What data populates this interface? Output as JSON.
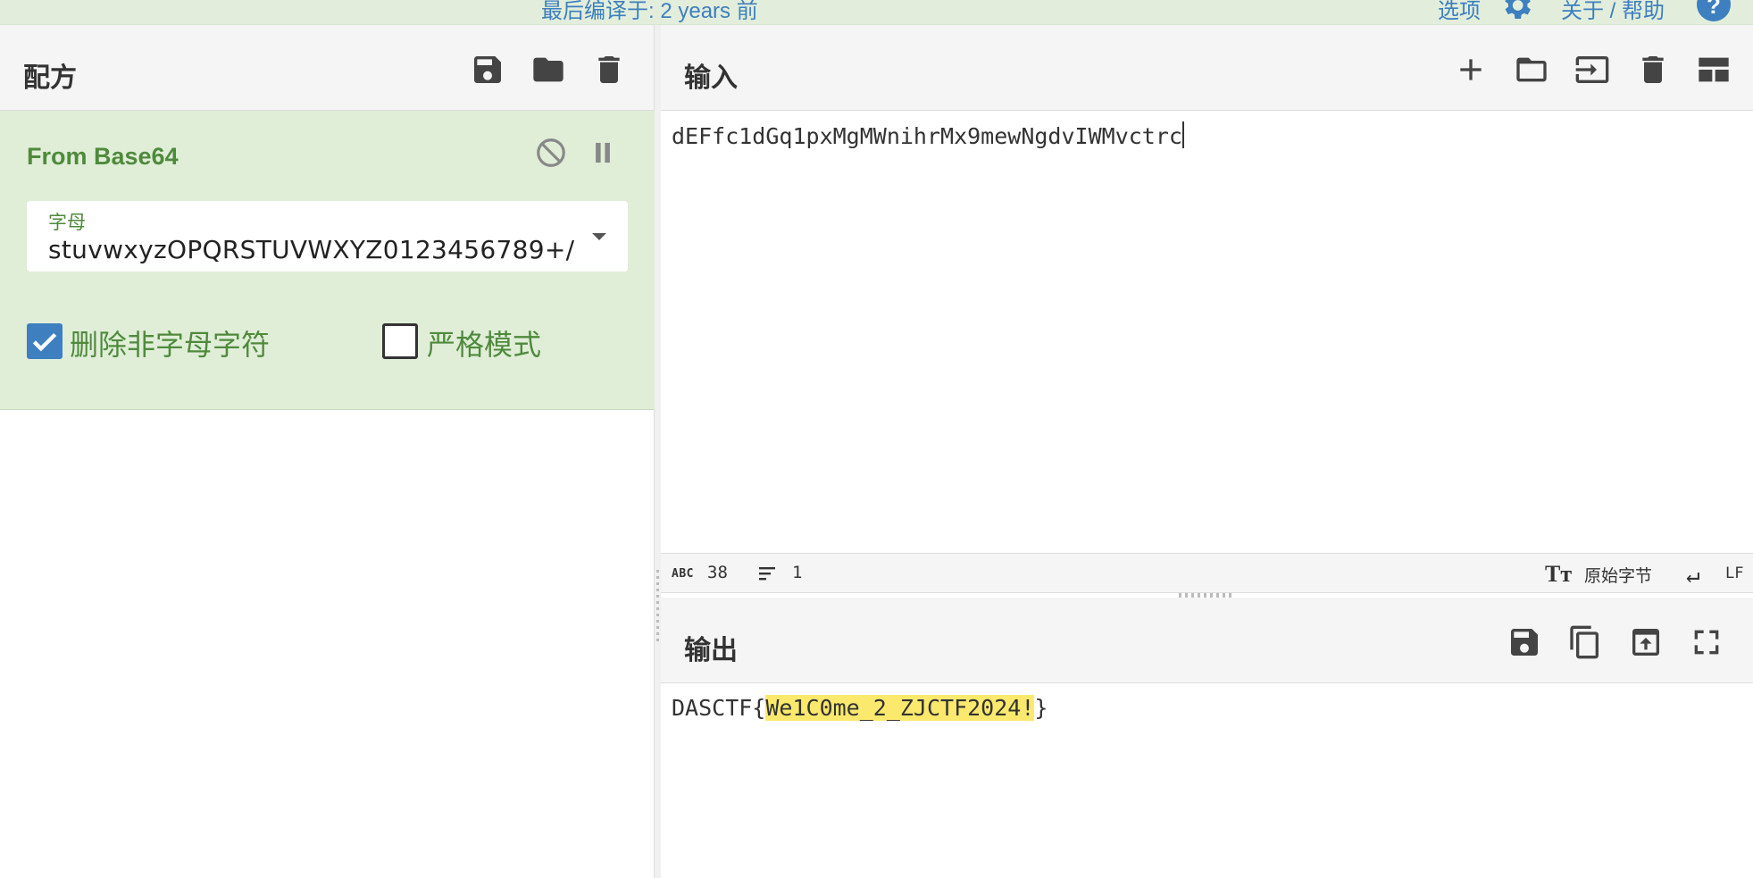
{
  "topbar": {
    "build_text": "最后编译于: 2 years 前",
    "options_label": "选项",
    "about_label": "关于 / 帮助",
    "help_glyph": "?"
  },
  "recipe": {
    "title": "配方",
    "operation": {
      "name": "From Base64",
      "alphabet_label": "字母",
      "alphabet_value": "stuvwxyzOPQRSTUVWXYZ0123456789+/",
      "remove_non_alpha_label": "删除非字母字符",
      "remove_non_alpha_checked": true,
      "strict_mode_label": "严格模式",
      "strict_mode_checked": false
    }
  },
  "input": {
    "title": "输入",
    "text": "dEFfc1dGq1pxMgMWnihrMx9mewNgdvIWMvctrc"
  },
  "status": {
    "abc_glyph": "ABC",
    "length": "38",
    "lines": "1",
    "tt_glyph": "Tт",
    "encoding": "原始字节",
    "eol_glyph": "↵",
    "eol": "LF"
  },
  "output": {
    "title": "输出",
    "prefix": "DASCTF{",
    "highlight": "We1C0me_2_ZJCTF2024!",
    "suffix": "}"
  },
  "colors": {
    "accent_blue": "#3d7fbf",
    "op_green_bg": "#e0eed8",
    "op_green_text": "#4f8a3c",
    "highlight_yellow": "#fbe96d"
  }
}
